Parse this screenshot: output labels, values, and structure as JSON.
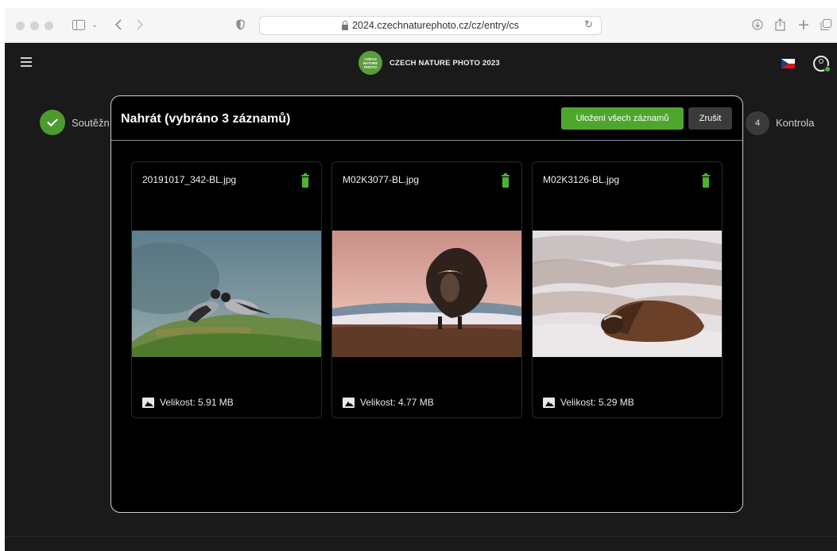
{
  "browser": {
    "url": "2024.czechnaturephoto.cz/cz/entry/cs",
    "icons": [
      "sidebar-icon",
      "chevron-down-icon",
      "back-icon",
      "forward-icon",
      "shield-icon",
      "lock-icon",
      "reload-icon",
      "download-icon",
      "share-icon",
      "new-tab-icon",
      "tabs-icon"
    ]
  },
  "appbar": {
    "logo_text": "CZECH NATURE PHOTO",
    "title": "CZECH NATURE PHOTO 2023"
  },
  "stepper": {
    "step1_label": "Soutěžní",
    "step4_number": "4",
    "step4_label": "Kontrola"
  },
  "modal": {
    "title": "Nahrát (vybráno 3 záznamů)",
    "save_all_label": "Uložení všech záznamů",
    "cancel_label": "Zrušit",
    "cards": [
      {
        "filename": "20191017_342-BL.jpg",
        "size": "Velikost: 5.91 MB"
      },
      {
        "filename": "M02K3077-BL.jpg",
        "size": "Velikost: 4.77 MB"
      },
      {
        "filename": "M02K3126-BL.jpg",
        "size": "Velikost: 5.29 MB"
      }
    ]
  },
  "colors": {
    "accent_green": "#4fa62f",
    "modal_bg": "#000000",
    "app_bg": "#1a1a1a"
  }
}
